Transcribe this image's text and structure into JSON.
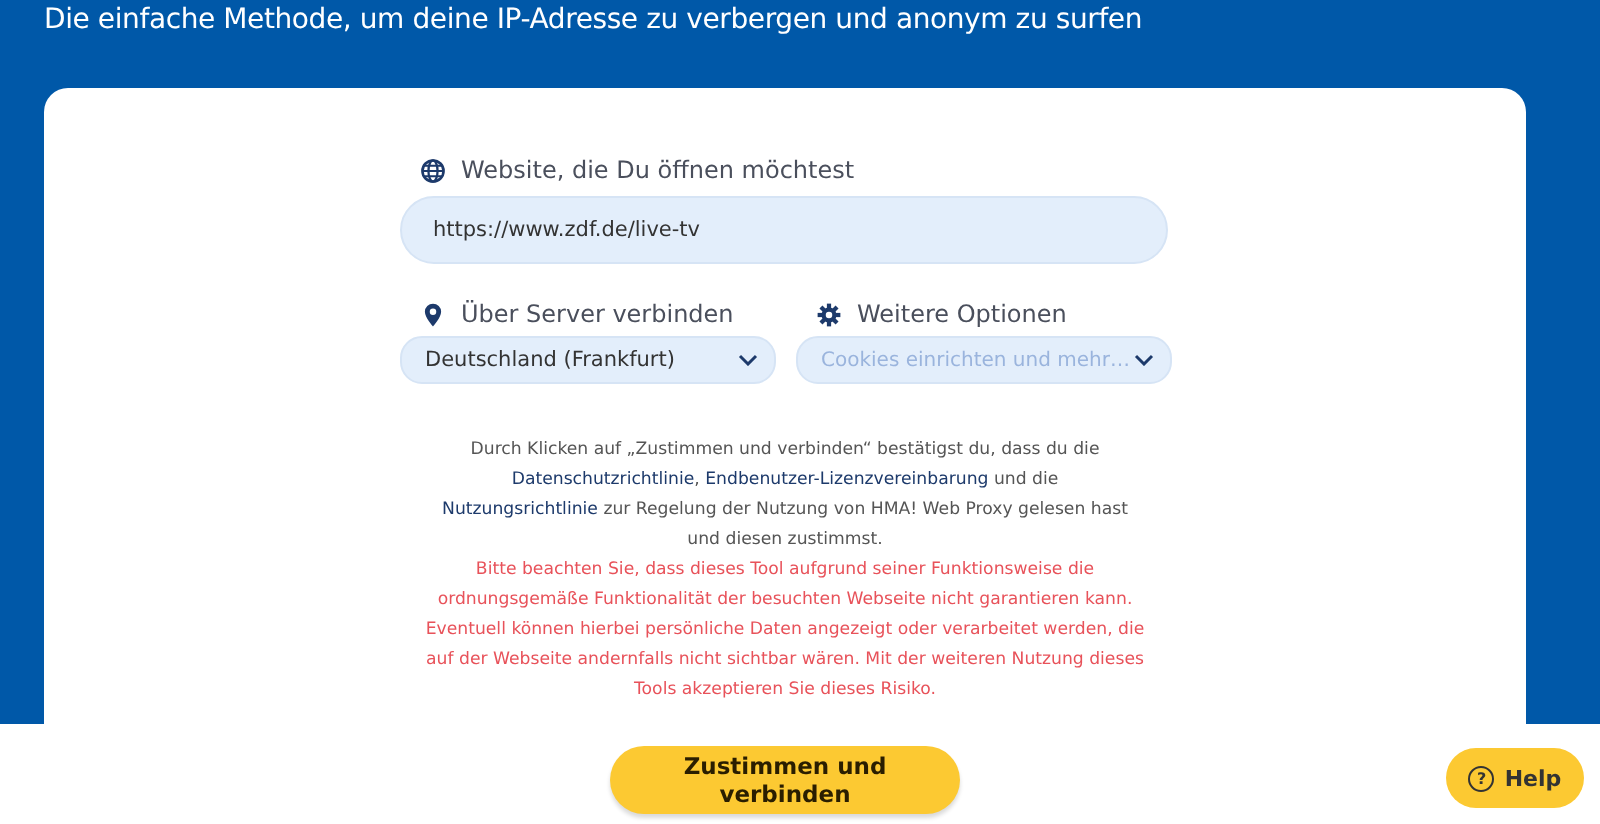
{
  "headline": "Die einfache Methode, um deine IP-Adresse zu verbergen und anonym zu surfen",
  "website_field": {
    "label": "Website, die Du öffnen möchtest",
    "value": "https://www.zdf.de/live-tv"
  },
  "server_select": {
    "label": "Über Server verbinden",
    "value": "Deutschland (Frankfurt)"
  },
  "options_select": {
    "label": "Weitere Optionen",
    "placeholder": "Cookies einrichten und mehr…"
  },
  "consent": [
    {
      "kind": "text",
      "text": "Durch Klicken auf „Zustimmen und verbinden“ bestätigst du, dass du die "
    },
    {
      "kind": "link",
      "text": "Datenschutzrichtlinie"
    },
    {
      "kind": "text",
      "text": ", "
    },
    {
      "kind": "link",
      "text": "Endbenutzer-Lizenzvereinbarung"
    },
    {
      "kind": "text",
      "text": " und die "
    },
    {
      "kind": "link",
      "text": "Nutzungsrichtlinie"
    },
    {
      "kind": "text",
      "text": " zur Regelung der Nutzung von HMA! Web Proxy gelesen hast und diesen zustimmst."
    }
  ],
  "warning": "Bitte beachten Sie, dass dieses Tool aufgrund seiner Funktionsweise die ordnungsgemäße Funktionalität der besuchten Webseite nicht garantieren kann. Eventuell können hierbei persönliche Daten angezeigt oder verarbeitet werden, die auf der Webseite andernfalls nicht sichtbar wären. Mit der weiteren Nutzung dieses Tools akzeptieren Sie dieses Risiko.",
  "submit_button": "Zustimmen und verbinden",
  "help_button": {
    "icon": "?",
    "label": "Help"
  }
}
